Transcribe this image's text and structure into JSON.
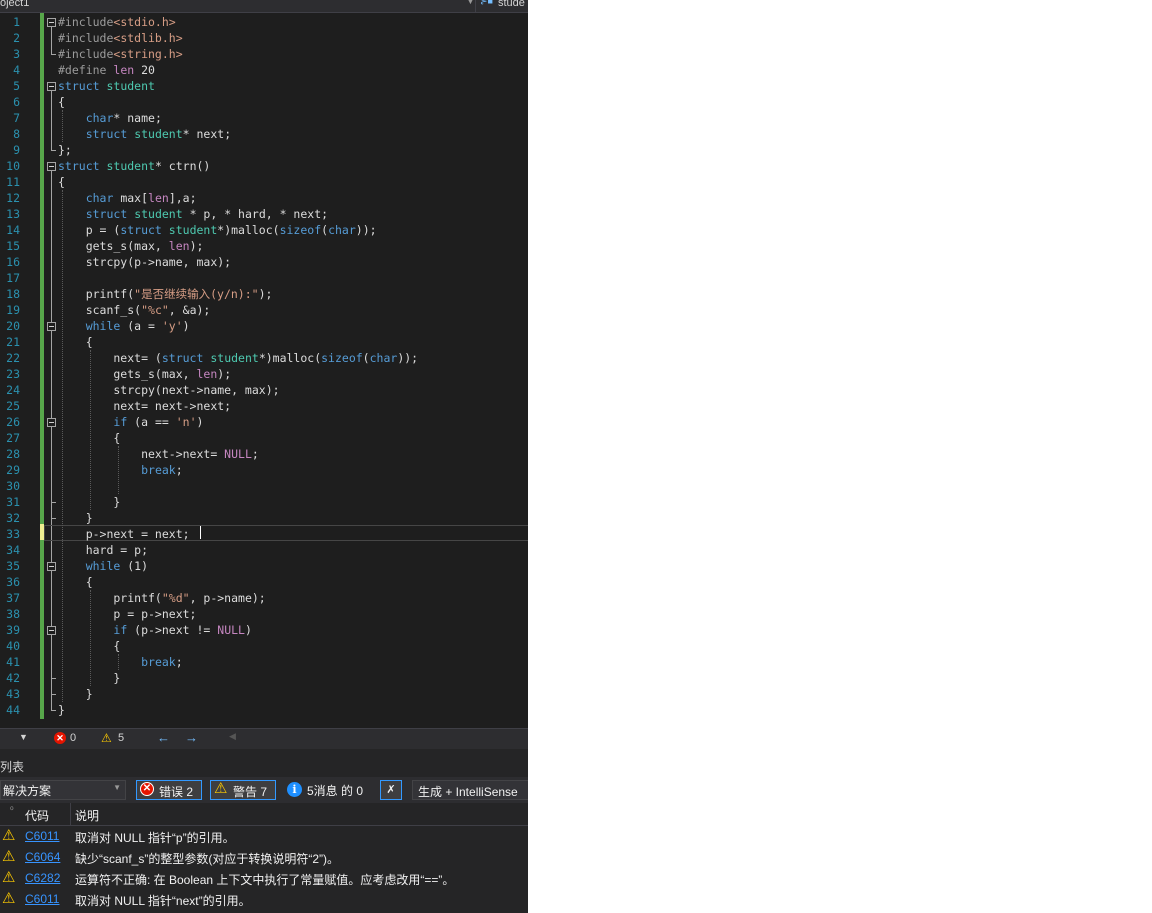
{
  "navbar": {
    "project": "oject1",
    "member": "stude"
  },
  "editor": {
    "line_numbers": [
      "1",
      "2",
      "3",
      "4",
      "5",
      "6",
      "7",
      "8",
      "9",
      "10",
      "11",
      "12",
      "13",
      "14",
      "15",
      "16",
      "17",
      "18",
      "19",
      "20",
      "21",
      "22",
      "23",
      "24",
      "25",
      "26",
      "27",
      "28",
      "29",
      "30",
      "31",
      "32",
      "33",
      "34",
      "35",
      "36",
      "37",
      "38",
      "39",
      "40",
      "41",
      "42",
      "43",
      "44"
    ],
    "lines": [
      "#include<stdio.h>",
      "#include<stdlib.h>",
      "#include<string.h>",
      "#define len 20",
      "struct student",
      "{",
      "    char* name;",
      "    struct student* next;",
      "};",
      "struct student* ctrn()",
      "{",
      "    char max[len],a;",
      "    struct student * p, * hard, * next;",
      "    p = (struct student*)malloc(sizeof(char));",
      "    gets_s(max, len);",
      "    strcpy(p->name, max);",
      "",
      "    printf(\"是否继续输入(y/n):\");",
      "    scanf_s(\"%c\", &a);",
      "    while (a = 'y')",
      "    {",
      "        next= (struct student*)malloc(sizeof(char));",
      "        gets_s(max, len);",
      "        strcpy(next->name, max);",
      "        next= next->next;",
      "        if (a == 'n')",
      "        {",
      "            next->next= NULL;",
      "            break;",
      "",
      "        }",
      "    }",
      "    p->next = next;",
      "    hard = p;",
      "    while (1)",
      "    {",
      "        printf(\"%d\", p->name);",
      "        p = p->next;",
      "        if (p->next != NULL)",
      "        {",
      "            break;",
      "        }",
      "    }",
      "}"
    ]
  },
  "status": {
    "errors": "0",
    "warnings": "5"
  },
  "error_list": {
    "title": "列表",
    "scope": "解决方案",
    "errors_label": "错误 2",
    "warnings_label": "警告 7",
    "messages_label": "5消息 的 0",
    "build_source": "生成 + IntelliSense",
    "col_code": "代码",
    "col_desc": "说明",
    "rows": [
      {
        "code": "C6011",
        "desc": "取消对 NULL 指针“p”的引用。"
      },
      {
        "code": "C6064",
        "desc": "缺少“scanf_s”的整型参数(对应于转换说明符“2”)。"
      },
      {
        "code": "C6282",
        "desc": "运算符不正确: 在 Boolean 上下文中执行了常量赋值。应考虑改用“==”。"
      },
      {
        "code": "C6011",
        "desc": "取消对 NULL 指针“next”的引用。"
      }
    ]
  },
  "colors": {
    "keyword": "#569cd6",
    "type": "#4ec9b0",
    "string": "#d69d85",
    "preproc": "#9b9b9b",
    "macro": "#c586c0",
    "linenum": "#2b91af",
    "changebar": "#57a64a"
  }
}
